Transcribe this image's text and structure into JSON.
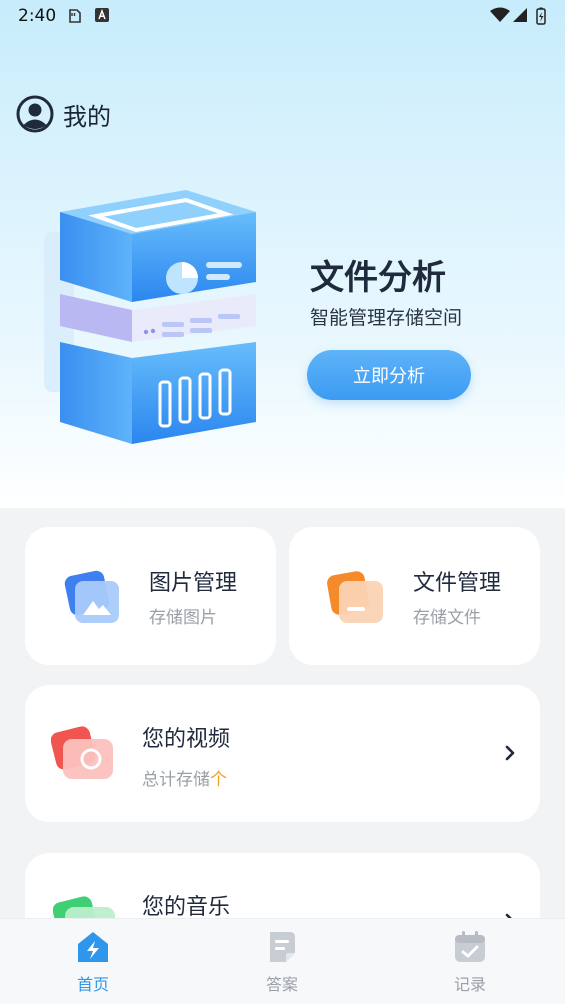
{
  "status_bar": {
    "time": "2:40"
  },
  "profile": {
    "title": "我的"
  },
  "hero": {
    "title": "文件分析",
    "subtitle": "智能管理存储空间",
    "button_label": "立即分析"
  },
  "cards": {
    "images": {
      "title": "图片管理",
      "subtitle": "存储图片"
    },
    "files": {
      "title": "文件管理",
      "subtitle": "存储文件"
    },
    "videos": {
      "title": "您的视频",
      "subtitle_prefix": "总计存储",
      "subtitle_unit": "个"
    },
    "music": {
      "title": "您的音乐"
    }
  },
  "tabs": [
    {
      "label": "首页",
      "icon": "home-bolt-icon",
      "active": true
    },
    {
      "label": "答案",
      "icon": "document-icon",
      "active": false
    },
    {
      "label": "记录",
      "icon": "calendar-check-icon",
      "active": false
    }
  ],
  "colors": {
    "accent": "#3c9bf2",
    "active_tab": "#2f96ec",
    "highlight": "#f0a21b"
  }
}
